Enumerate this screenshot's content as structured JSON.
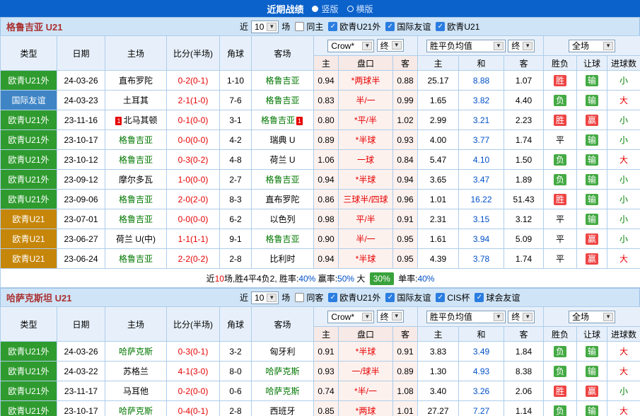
{
  "topbar": {
    "title": "近期战绩",
    "options": [
      {
        "label": "竖版",
        "selected": true
      },
      {
        "label": "横版",
        "selected": false
      }
    ]
  },
  "table_headers": {
    "type": "类型",
    "date": "日期",
    "home": "主场",
    "score": "比分(半场)",
    "corners": "角球",
    "away": "客场",
    "odds_company": "Crow*",
    "final": "终",
    "avg": "胜平负均值",
    "scope": "全场",
    "sub_home": "主",
    "sub_handicap": "盘口",
    "sub_away": "客",
    "sub_avg_home": "主",
    "sub_avg_draw": "和",
    "sub_avg_away": "客",
    "sub_result": "胜负",
    "sub_let": "让球",
    "sub_goals": "进球数"
  },
  "color_maps": {
    "type": {
      "欧青U21外": "#2f9b2f",
      "国际友谊": "#3f85c6",
      "欧青U21": "#c6860a"
    },
    "result": {
      "胜": "#ee4444",
      "负": "#44aa44"
    },
    "let": {
      "赢": "#ee4444",
      "输": "#44aa44"
    },
    "goals": {
      "大": "#e60000",
      "小": "#008000"
    }
  },
  "sections": [
    {
      "team_title": "格鲁吉亚 U21",
      "filters": {
        "near": "近",
        "count": "10",
        "games": "场",
        "same": {
          "label": "同主",
          "checked": false
        },
        "competitions": [
          {
            "label": "欧青U21外",
            "checked": true
          },
          {
            "label": "国际友谊",
            "checked": true
          },
          {
            "label": "欧青U21",
            "checked": true
          }
        ]
      },
      "rows": [
        {
          "type": "欧青U21外",
          "date": "24-03-26",
          "home": "直布罗陀",
          "home_focus": false,
          "score": "0-2(0-1)",
          "corners": "1-10",
          "away": "格鲁吉亚",
          "away_focus": true,
          "odds": [
            "0.94",
            "*两球半",
            "0.88"
          ],
          "avg": [
            "25.17",
            "8.88",
            "1.07"
          ],
          "result": "胜",
          "let": "输",
          "goals": "小"
        },
        {
          "type": "国际友谊",
          "date": "24-03-23",
          "home": "土耳其",
          "home_focus": false,
          "score": "2-1(1-0)",
          "corners": "7-6",
          "away": "格鲁吉亚",
          "away_focus": true,
          "odds": [
            "0.83",
            "半/一",
            "0.99"
          ],
          "avg": [
            "1.65",
            "3.82",
            "4.40"
          ],
          "result": "负",
          "let": "输",
          "goals": "大"
        },
        {
          "type": "欧青U21外",
          "date": "23-11-16",
          "home": "北马其顿",
          "home_focus": false,
          "home_card": "1",
          "score": "0-1(0-0)",
          "corners": "3-1",
          "away": "格鲁吉亚",
          "away_focus": true,
          "away_card": "1",
          "odds": [
            "0.80",
            "*平/半",
            "1.02"
          ],
          "avg": [
            "2.99",
            "3.21",
            "2.23"
          ],
          "result": "胜",
          "let": "赢",
          "goals": "小"
        },
        {
          "type": "欧青U21外",
          "date": "23-10-17",
          "home": "格鲁吉亚",
          "home_focus": true,
          "score": "0-0(0-0)",
          "corners": "4-2",
          "away": "瑞典 U",
          "away_focus": false,
          "odds": [
            "0.89",
            "*半球",
            "0.93"
          ],
          "avg": [
            "4.00",
            "3.77",
            "1.74"
          ],
          "result": "平",
          "let": "输",
          "goals": "小"
        },
        {
          "type": "欧青U21外",
          "date": "23-10-12",
          "home": "格鲁吉亚",
          "home_focus": true,
          "score": "0-3(0-2)",
          "corners": "4-8",
          "away": "荷兰 U",
          "away_focus": false,
          "odds": [
            "1.06",
            "一球",
            "0.84"
          ],
          "avg": [
            "5.47",
            "4.10",
            "1.50"
          ],
          "result": "负",
          "let": "输",
          "goals": "大"
        },
        {
          "type": "欧青U21外",
          "date": "23-09-12",
          "home": "摩尔多瓦",
          "home_focus": false,
          "score": "1-0(0-0)",
          "corners": "2-7",
          "away": "格鲁吉亚",
          "away_focus": true,
          "odds": [
            "0.94",
            "*半球",
            "0.94"
          ],
          "avg": [
            "3.65",
            "3.47",
            "1.89"
          ],
          "result": "负",
          "let": "输",
          "goals": "小"
        },
        {
          "type": "欧青U21外",
          "date": "23-09-06",
          "home": "格鲁吉亚",
          "home_focus": true,
          "score": "2-0(2-0)",
          "corners": "8-3",
          "away": "直布罗陀",
          "away_focus": false,
          "odds": [
            "0.86",
            "三球半/四球",
            "0.96"
          ],
          "avg": [
            "1.01",
            "16.22",
            "51.43"
          ],
          "result": "胜",
          "let": "输",
          "goals": "小"
        },
        {
          "type": "欧青U21",
          "date": "23-07-01",
          "home": "格鲁吉亚",
          "home_focus": true,
          "score": "0-0(0-0)",
          "corners": "6-2",
          "away": "以色列",
          "away_focus": false,
          "odds": [
            "0.98",
            "平/半",
            "0.91"
          ],
          "avg": [
            "2.31",
            "3.15",
            "3.12"
          ],
          "result": "平",
          "let": "输",
          "goals": "小"
        },
        {
          "type": "欧青U21",
          "date": "23-06-27",
          "home": "荷兰 U(中)",
          "home_focus": false,
          "score": "1-1(1-1)",
          "corners": "9-1",
          "away": "格鲁吉亚",
          "away_focus": true,
          "odds": [
            "0.90",
            "半/一",
            "0.95"
          ],
          "avg": [
            "1.61",
            "3.94",
            "5.09"
          ],
          "result": "平",
          "let": "赢",
          "goals": "小"
        },
        {
          "type": "欧青U21",
          "date": "23-06-24",
          "home": "格鲁吉亚",
          "home_focus": true,
          "score": "2-2(0-2)",
          "corners": "2-8",
          "away": "比利时",
          "away_focus": false,
          "odds": [
            "0.94",
            "*半球",
            "0.95"
          ],
          "avg": [
            "4.39",
            "3.78",
            "1.74"
          ],
          "result": "平",
          "let": "赢",
          "goals": "大"
        }
      ],
      "summary": {
        "parts": [
          {
            "text": "近",
            "style": "plain"
          },
          {
            "text": "10",
            "style": "red"
          },
          {
            "text": "场,胜4平4负2, 胜率:",
            "style": "plain"
          },
          {
            "text": "40%",
            "style": "blue"
          },
          {
            "text": " 赢率:",
            "style": "plain"
          },
          {
            "text": "50%",
            "style": "blue"
          },
          {
            "text": " 大 ",
            "style": "plain"
          },
          {
            "text": "30%",
            "style": "greenBadge"
          },
          {
            "text": " 单率:",
            "style": "plain"
          },
          {
            "text": "40%",
            "style": "blue"
          }
        ]
      }
    },
    {
      "team_title": "哈萨克斯坦 U21",
      "filters": {
        "near": "近",
        "count": "10",
        "games": "场",
        "same": {
          "label": "同客",
          "checked": false
        },
        "competitions": [
          {
            "label": "欧青U21外",
            "checked": true
          },
          {
            "label": "国际友谊",
            "checked": true
          },
          {
            "label": "CIS杯",
            "checked": true
          },
          {
            "label": "球会友谊",
            "checked": true
          }
        ]
      },
      "rows": [
        {
          "type": "欧青U21外",
          "date": "24-03-26",
          "home": "哈萨克斯",
          "home_focus": true,
          "score": "0-3(0-1)",
          "corners": "3-2",
          "away": "匈牙利",
          "away_focus": false,
          "odds": [
            "0.91",
            "*半球",
            "0.91"
          ],
          "avg": [
            "3.83",
            "3.49",
            "1.84"
          ],
          "result": "负",
          "let": "输",
          "goals": "大"
        },
        {
          "type": "欧青U21外",
          "date": "24-03-22",
          "home": "苏格兰",
          "home_focus": false,
          "score": "4-1(3-0)",
          "corners": "8-0",
          "away": "哈萨克斯",
          "away_focus": true,
          "odds": [
            "0.93",
            "一/球半",
            "0.89"
          ],
          "avg": [
            "1.30",
            "4.93",
            "8.38"
          ],
          "result": "负",
          "let": "输",
          "goals": "大"
        },
        {
          "type": "欧青U21外",
          "date": "23-11-17",
          "home": "马耳他",
          "home_focus": false,
          "score": "0-2(0-0)",
          "corners": "0-6",
          "away": "哈萨克斯",
          "away_focus": true,
          "odds": [
            "0.74",
            "*半/一",
            "1.08"
          ],
          "avg": [
            "3.40",
            "3.26",
            "2.06"
          ],
          "result": "胜",
          "let": "赢",
          "goals": "小"
        },
        {
          "type": "欧青U21外",
          "date": "23-10-17",
          "home": "哈萨克斯",
          "home_focus": true,
          "score": "0-4(0-1)",
          "corners": "2-8",
          "away": "西班牙",
          "away_focus": false,
          "odds": [
            "0.85",
            "*两球",
            "1.01"
          ],
          "avg": [
            "27.27",
            "7.27",
            "1.14"
          ],
          "result": "负",
          "let": "输",
          "goals": "大"
        }
      ]
    }
  ]
}
